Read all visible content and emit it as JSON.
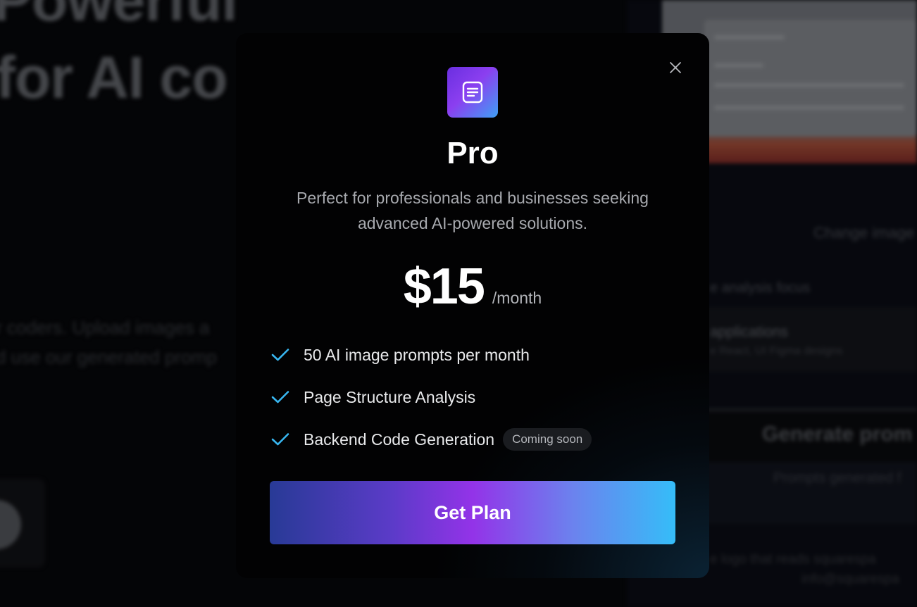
{
  "background": {
    "heading_line_1": "Powerful",
    "heading_line_2": "for AI co",
    "paragraph_line_1": "r coders. Upload images a",
    "paragraph_line_2": "d use our generated promp",
    "right_label_change": "Change image",
    "right_label_focus": "e analysis focus",
    "right_label_apps": "applications",
    "right_label_apps_sub": "e React, UI Figma designs",
    "right_generate": "Generate prom",
    "right_generated_note": "Prompts generated f",
    "right_footer_1": "e logo that reads squarespa",
    "right_footer_2": "info@squarespa"
  },
  "modal": {
    "close_icon": "close-icon",
    "plan_icon": "document-icon",
    "plan_name": "Pro",
    "description": "Perfect for professionals and businesses seeking advanced AI-powered solutions.",
    "price": "$15",
    "period": "/month",
    "features": [
      {
        "label": "50 AI image prompts per month",
        "badge": null
      },
      {
        "label": "Page Structure Analysis",
        "badge": null
      },
      {
        "label": "Backend Code Generation",
        "badge": "Coming soon"
      }
    ],
    "cta_label": "Get Plan"
  },
  "colors": {
    "check": "#38b6f0",
    "cta_gradient_start": "#283a96",
    "cta_gradient_mid": "#9333e8",
    "cta_gradient_end": "#35bdf8",
    "icon_gradient_start": "#6a2fe0",
    "icon_gradient_end": "#3fa0f5"
  }
}
